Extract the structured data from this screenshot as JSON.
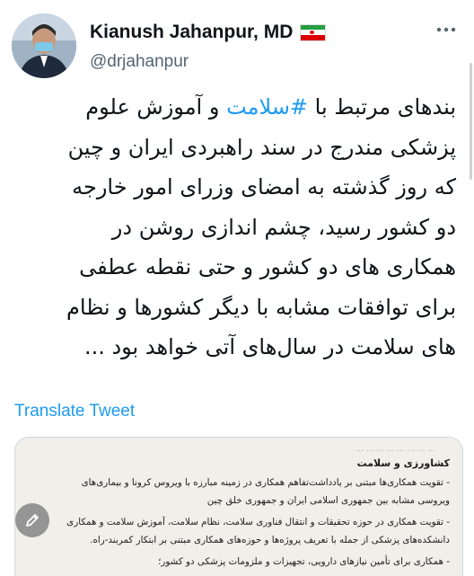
{
  "author": {
    "name": "Kianush Jahanpur, MD",
    "handle": "@drjahanpur",
    "flag": {
      "colors": [
        "#239f40",
        "#ffffff",
        "#da0000"
      ]
    }
  },
  "tweet": {
    "line1_before": "بندهای مرتبط با ",
    "hashtag": "#سلامت",
    "line1_after": " و آموزش علوم",
    "lines": [
      "پزشکی مندرج در سند راهبردی ایران و چین",
      "که روز گذشته به امضای وزرای امور خارجه",
      "دو کشور رسید، چشم اندازی روشن در",
      "همکاری های دو کشور و حتی نقطه عطفی",
      "برای توافقات مشابه با دیگر کشورها و نظام",
      "های سلامت در سال‌های آتی خواهد بود ..."
    ]
  },
  "translate_label": "Translate Tweet",
  "document": {
    "faint": "... ... ... ... ... ... ... ...",
    "heading": "کشاورزی و سلامت",
    "lines": [
      "- تقویت همکاری‌ها مبتنی بر یادداشت‌تفاهم همکاری در زمینه مبارزه با ویروس کرونا و بیماری‌های",
      "ویروسی مشابه بین جمهوری اسلامی ایران و جمهوری خلق چین",
      "- تقویت همکاری در حوزه تحقیقات و انتقال فناوری سلامت، نظام سلامت، آموزش سلامت و همکاری",
      "دانشکده‌های پزشکی از جمله با تعریف پروژه‌ها و حوزه‌های همکاری مبتنی بر ابتکار کمربند-راه.",
      "- همکاری برای تأمین نیازهای دارویی، تجهیزات و ملزومات پزشکی دو کشور؛"
    ]
  },
  "icons": {
    "more": "more-options-icon",
    "compose": "compose-pencil-icon"
  },
  "colors": {
    "accent": "#1d9bf0",
    "text": "#0f1419",
    "secondary": "#536471"
  }
}
